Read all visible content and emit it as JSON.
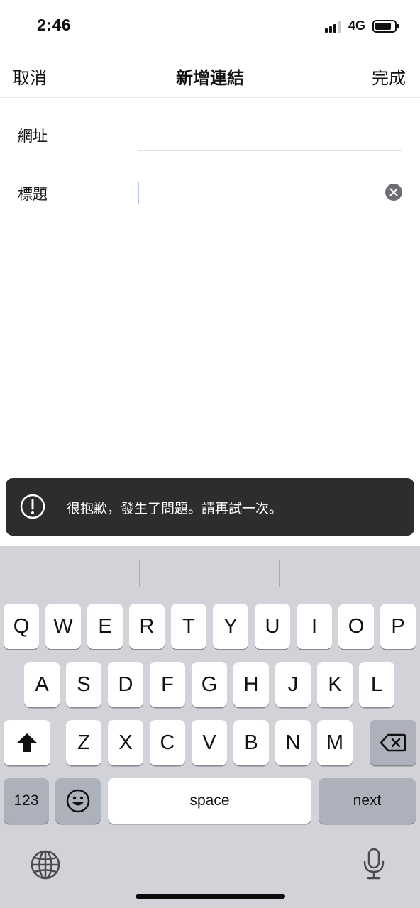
{
  "status_bar": {
    "time": "2:46",
    "network": "4G",
    "signal_bars": 3,
    "signal_bars_total": 4,
    "battery_icon": "battery-icon"
  },
  "nav": {
    "cancel": "取消",
    "title": "新增連結",
    "done": "完成"
  },
  "form": {
    "url": {
      "label": "網址",
      "value": ""
    },
    "title": {
      "label": "標題",
      "value": ""
    }
  },
  "toast": {
    "icon": "exclamation-circle-icon",
    "message": "很抱歉，發生了問題。請再試一次。"
  },
  "keyboard": {
    "row1": [
      "Q",
      "W",
      "E",
      "R",
      "T",
      "Y",
      "U",
      "I",
      "O",
      "P"
    ],
    "row2": [
      "A",
      "S",
      "D",
      "F",
      "G",
      "H",
      "J",
      "K",
      "L"
    ],
    "row3": [
      "Z",
      "X",
      "C",
      "V",
      "B",
      "N",
      "M"
    ],
    "numbers_key": "123",
    "space_key": "space",
    "next_key": "next",
    "icons": {
      "shift": "shift-icon",
      "delete": "backspace-icon",
      "emoji": "emoji-icon",
      "globe": "globe-icon",
      "mic": "microphone-icon"
    }
  },
  "colors": {
    "toast_bg": "#2d2d2f",
    "keyboard_bg": "#d1d3d9",
    "key_dark": "#adb1bb"
  }
}
